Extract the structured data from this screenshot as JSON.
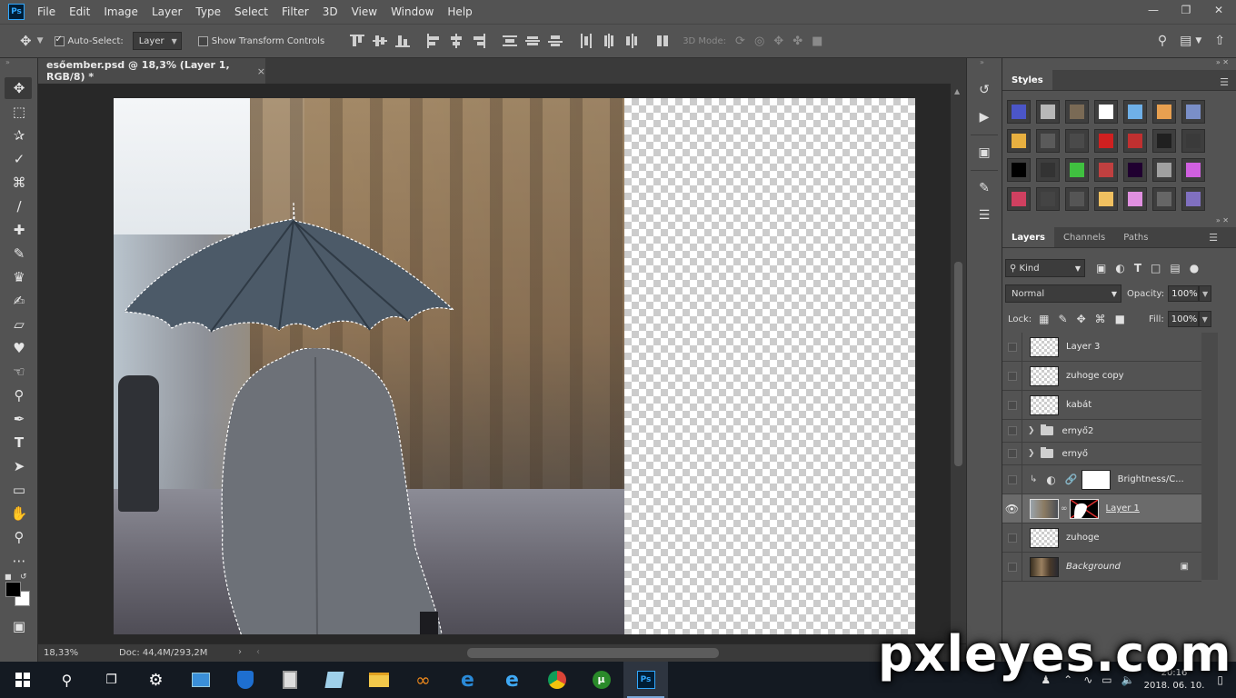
{
  "menu": {
    "logo": "Ps",
    "items": [
      "File",
      "Edit",
      "Image",
      "Layer",
      "Type",
      "Select",
      "Filter",
      "3D",
      "View",
      "Window",
      "Help"
    ]
  },
  "options": {
    "auto_select_label": "Auto-Select:",
    "auto_select_checked": true,
    "auto_select_target": "Layer",
    "transform_controls_label": "Show Transform Controls",
    "transform_controls_checked": false,
    "mode_3d_label": "3D Mode:"
  },
  "document": {
    "tab_title": "esőember.psd @ 18,3% (Layer 1, RGB/8) *",
    "close": "×"
  },
  "status": {
    "zoom": "18,33%",
    "doc_info": "Doc: 44,4M/293,2M"
  },
  "styles_panel": {
    "title": "Styles",
    "swatches": [
      "#4b56c8",
      "#b8b8b8",
      "#7a6a55",
      "#ffffff",
      "#6fb0e8",
      "#e8a050",
      "#7a8fc8",
      "#e8b040",
      "#5a5a5a",
      "#4a4a4a",
      "#d02020",
      "#c03030",
      "#202020",
      "#3a3a3a",
      "#000000",
      "#333333",
      "#40c040",
      "#c04040",
      "#200030",
      "#a0a0a0",
      "#d060e0",
      "#d04060",
      "#444444",
      "#555555",
      "#f0c060",
      "#e090e0",
      "#666666",
      "#8070c0"
    ]
  },
  "layers_panel": {
    "tabs": [
      "Layers",
      "Channels",
      "Paths"
    ],
    "kind_label": "Kind",
    "blend_mode": "Normal",
    "opacity_label": "Opacity:",
    "opacity_value": "100%",
    "lock_label": "Lock:",
    "fill_label": "Fill:",
    "fill_value": "100%",
    "layers": [
      {
        "name": "Layer 3",
        "type": "layer",
        "visible": false
      },
      {
        "name": "zuhoge copy",
        "type": "layer",
        "visible": false
      },
      {
        "name": "kabát",
        "type": "layer",
        "visible": false
      },
      {
        "name": "ernyő2",
        "type": "group",
        "visible": false
      },
      {
        "name": "ernyő",
        "type": "group",
        "visible": false
      },
      {
        "name": "Brightness/C...",
        "type": "adjustment",
        "visible": false
      },
      {
        "name": "Layer 1",
        "type": "masked",
        "visible": true,
        "selected": true
      },
      {
        "name": "zuhoge",
        "type": "layer",
        "visible": false
      },
      {
        "name": "Background",
        "type": "background",
        "visible": false,
        "locked": true
      }
    ]
  },
  "taskbar": {
    "clock_time": "20:16",
    "clock_date": "2018. 06. 10."
  },
  "watermark": "pxleyes.com"
}
